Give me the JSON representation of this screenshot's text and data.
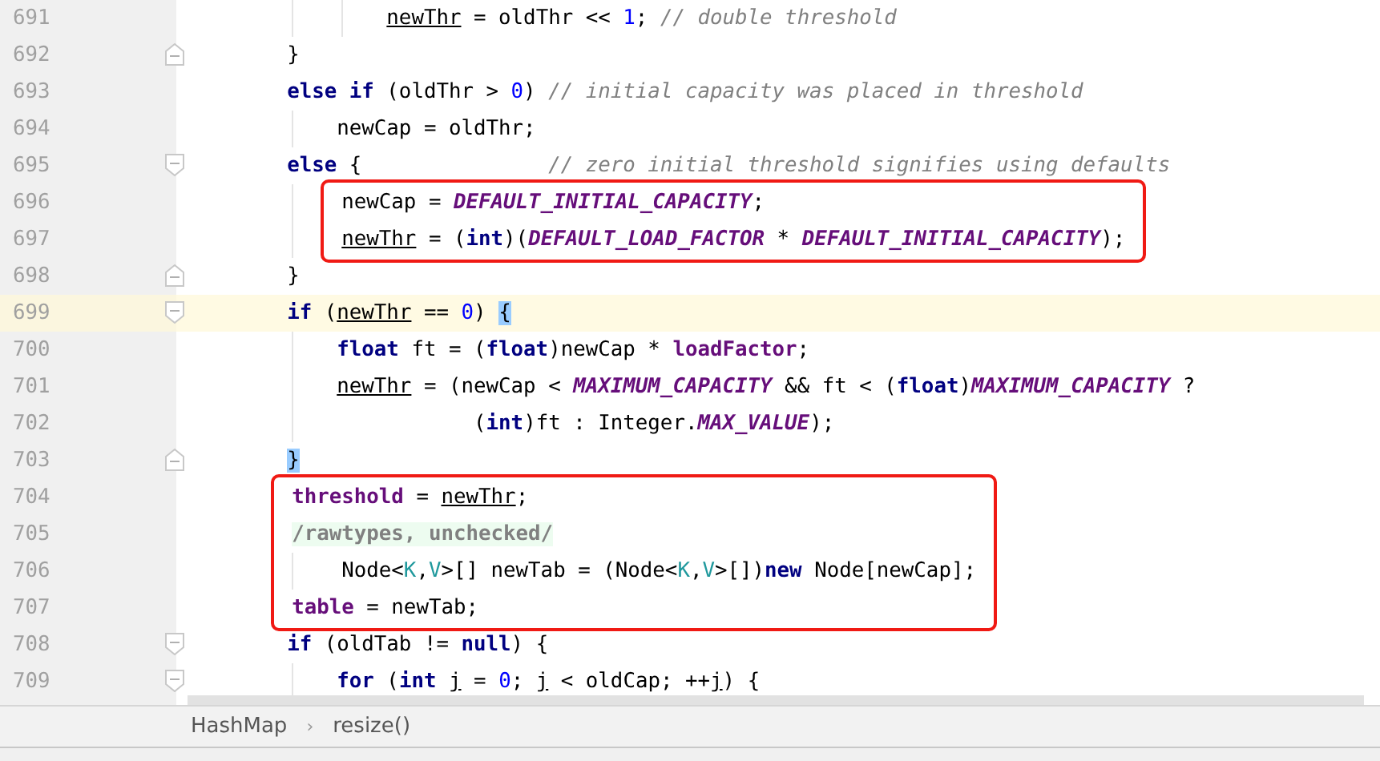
{
  "editor": {
    "items": [
      {
        "kind": "group",
        "children": [
          {
            "kind": "group",
            "children": [
              {
                "kind": "line",
                "number": "691",
                "block_start": false,
                "block_end": false,
                "current": false,
                "tokens": [
                  {
                    "kind": "reassigned",
                    "text": "newThr"
                  },
                  {
                    "kind": "text",
                    "text": " = oldThr << "
                  },
                  {
                    "kind": "number",
                    "text": "1"
                  },
                  {
                    "kind": "text",
                    "text": "; "
                  },
                  {
                    "kind": "comment",
                    "text": "// double threshold"
                  }
                ]
              }
            ]
          }
        ]
      },
      {
        "kind": "line",
        "number": "692",
        "block_start": false,
        "block_end": true,
        "current": false,
        "tokens": [
          {
            "kind": "text",
            "text": "}"
          }
        ]
      },
      {
        "kind": "line",
        "number": "693",
        "block_start": false,
        "block_end": false,
        "current": false,
        "tokens": [
          {
            "kind": "keyword",
            "text": "else if"
          },
          {
            "kind": "text",
            "text": " (oldThr > "
          },
          {
            "kind": "number",
            "text": "0"
          },
          {
            "kind": "text",
            "text": ") "
          },
          {
            "kind": "comment",
            "text": "// initial capacity was placed in threshold"
          }
        ],
        "children": [
          {
            "kind": "line",
            "number": "694",
            "block_start": false,
            "block_end": false,
            "current": false,
            "tokens": [
              {
                "kind": "text",
                "text": "newCap = oldThr;"
              }
            ]
          }
        ]
      },
      {
        "kind": "line",
        "number": "695",
        "block_start": true,
        "block_end": false,
        "current": false,
        "tokens": [
          {
            "kind": "keyword",
            "text": "else"
          },
          {
            "kind": "text",
            "text": " {               "
          },
          {
            "kind": "comment",
            "text": "// zero initial threshold signifies using defaults"
          }
        ],
        "children": [
          {
            "kind": "frame",
            "lines": [
              {
                "kind": "line",
                "number": "696",
                "block_start": false,
                "block_end": false,
                "current": false,
                "tokens": [
                  {
                    "kind": "text",
                    "text": "newCap = "
                  },
                  {
                    "kind": "constant",
                    "text": "DEFAULT_INITIAL_CAPACITY"
                  },
                  {
                    "kind": "text",
                    "text": ";"
                  }
                ]
              },
              {
                "kind": "line",
                "number": "697",
                "block_start": false,
                "block_end": false,
                "current": false,
                "tokens": [
                  {
                    "kind": "reassigned",
                    "text": "newThr"
                  },
                  {
                    "kind": "text",
                    "text": " = ("
                  },
                  {
                    "kind": "keyword",
                    "text": "int"
                  },
                  {
                    "kind": "text",
                    "text": ")("
                  },
                  {
                    "kind": "constant",
                    "text": "DEFAULT_LOAD_FACTOR"
                  },
                  {
                    "kind": "text",
                    "text": " * "
                  },
                  {
                    "kind": "constant",
                    "text": "DEFAULT_INITIAL_CAPACITY"
                  },
                  {
                    "kind": "text",
                    "text": ");"
                  }
                ]
              }
            ]
          }
        ]
      },
      {
        "kind": "line",
        "number": "698",
        "block_start": false,
        "block_end": true,
        "current": false,
        "tokens": [
          {
            "kind": "text",
            "text": "}"
          }
        ]
      },
      {
        "kind": "line",
        "number": "699",
        "block_start": true,
        "block_end": false,
        "current": true,
        "tokens": [
          {
            "kind": "keyword",
            "text": "if"
          },
          {
            "kind": "text",
            "text": " ("
          },
          {
            "kind": "reassigned",
            "text": "newThr"
          },
          {
            "kind": "text",
            "text": " == "
          },
          {
            "kind": "number",
            "text": "0"
          },
          {
            "kind": "text",
            "text": ") "
          },
          {
            "kind": "match",
            "text": "{"
          }
        ],
        "children": [
          {
            "kind": "line",
            "number": "700",
            "block_start": false,
            "block_end": false,
            "current": false,
            "tokens": [
              {
                "kind": "keyword",
                "text": "float"
              },
              {
                "kind": "text",
                "text": " ft = ("
              },
              {
                "kind": "keyword",
                "text": "float"
              },
              {
                "kind": "text",
                "text": ")newCap * "
              },
              {
                "kind": "field",
                "text": "loadFactor"
              },
              {
                "kind": "text",
                "text": ";"
              }
            ]
          },
          {
            "kind": "line",
            "number": "701",
            "block_start": false,
            "block_end": false,
            "current": false,
            "tokens": [
              {
                "kind": "reassigned",
                "text": "newThr"
              },
              {
                "kind": "text",
                "text": " = (newCap < "
              },
              {
                "kind": "constant",
                "text": "MAXIMUM_CAPACITY"
              },
              {
                "kind": "text",
                "text": " && ft < ("
              },
              {
                "kind": "keyword",
                "text": "float"
              },
              {
                "kind": "text",
                "text": ")"
              },
              {
                "kind": "constant",
                "text": "MAXIMUM_CAPACITY"
              },
              {
                "kind": "text",
                "text": " ?"
              }
            ]
          },
          {
            "kind": "line",
            "number": "702",
            "block_start": false,
            "block_end": false,
            "current": false,
            "tokens": [
              {
                "kind": "text",
                "text": "           ("
              },
              {
                "kind": "keyword",
                "text": "int"
              },
              {
                "kind": "text",
                "text": ")ft : Integer."
              },
              {
                "kind": "constant",
                "text": "MAX_VALUE"
              },
              {
                "kind": "text",
                "text": ");"
              }
            ]
          }
        ]
      },
      {
        "kind": "line",
        "number": "703",
        "block_start": false,
        "block_end": true,
        "current": false,
        "tokens": [
          {
            "kind": "match",
            "text": "}"
          }
        ]
      },
      {
        "kind": "frame",
        "lines": [
          {
            "kind": "line",
            "number": "704",
            "block_start": false,
            "block_end": false,
            "current": false,
            "tokens": [
              {
                "kind": "field",
                "text": "threshold"
              },
              {
                "kind": "text",
                "text": " = "
              },
              {
                "kind": "reassigned",
                "text": "newThr"
              },
              {
                "kind": "text",
                "text": ";"
              }
            ]
          },
          {
            "kind": "line",
            "number": "705",
            "block_start": false,
            "block_end": false,
            "current": false,
            "tokens": [
              {
                "kind": "annotation",
                "text": "/rawtypes, unchecked/"
              }
            ],
            "children": [
              {
                "kind": "line",
                "number": "706",
                "block_start": false,
                "block_end": false,
                "current": false,
                "tokens": [
                  {
                    "kind": "text",
                    "text": "Node<"
                  },
                  {
                    "kind": "type-param",
                    "text": "K"
                  },
                  {
                    "kind": "text",
                    "text": ","
                  },
                  {
                    "kind": "type-param",
                    "text": "V"
                  },
                  {
                    "kind": "text",
                    "text": ">[] newTab = (Node<"
                  },
                  {
                    "kind": "type-param",
                    "text": "K"
                  },
                  {
                    "kind": "text",
                    "text": ","
                  },
                  {
                    "kind": "type-param",
                    "text": "V"
                  },
                  {
                    "kind": "text",
                    "text": ">[])"
                  },
                  {
                    "kind": "keyword",
                    "text": "new"
                  },
                  {
                    "kind": "text",
                    "text": " Node[newCap];"
                  }
                ]
              }
            ]
          },
          {
            "kind": "line",
            "number": "707",
            "block_start": false,
            "block_end": false,
            "current": false,
            "tokens": [
              {
                "kind": "field",
                "text": "table"
              },
              {
                "kind": "text",
                "text": " = newTab;"
              }
            ]
          }
        ]
      },
      {
        "kind": "line",
        "number": "708",
        "block_start": true,
        "block_end": false,
        "current": false,
        "tokens": [
          {
            "kind": "keyword",
            "text": "if"
          },
          {
            "kind": "text",
            "text": " (oldTab != "
          },
          {
            "kind": "keyword",
            "text": "null"
          },
          {
            "kind": "text",
            "text": ") {"
          }
        ],
        "children": [
          {
            "kind": "line",
            "number": "709",
            "block_start": true,
            "block_end": false,
            "current": false,
            "tokens": [
              {
                "kind": "keyword",
                "text": "for"
              },
              {
                "kind": "text",
                "text": " ("
              },
              {
                "kind": "keyword",
                "text": "int "
              },
              {
                "kind": "reassigned",
                "text": "j"
              },
              {
                "kind": "text",
                "text": " = "
              },
              {
                "kind": "number",
                "text": "0"
              },
              {
                "kind": "text",
                "text": "; "
              },
              {
                "kind": "reassigned",
                "text": "j"
              },
              {
                "kind": "text",
                "text": " < oldCap; ++"
              },
              {
                "kind": "reassigned",
                "text": "j"
              },
              {
                "kind": "text",
                "text": ") {"
              }
            ]
          }
        ]
      }
    ]
  },
  "breadcrumbs": {
    "items": [
      "HashMap",
      "resize()"
    ],
    "separator": "›"
  }
}
